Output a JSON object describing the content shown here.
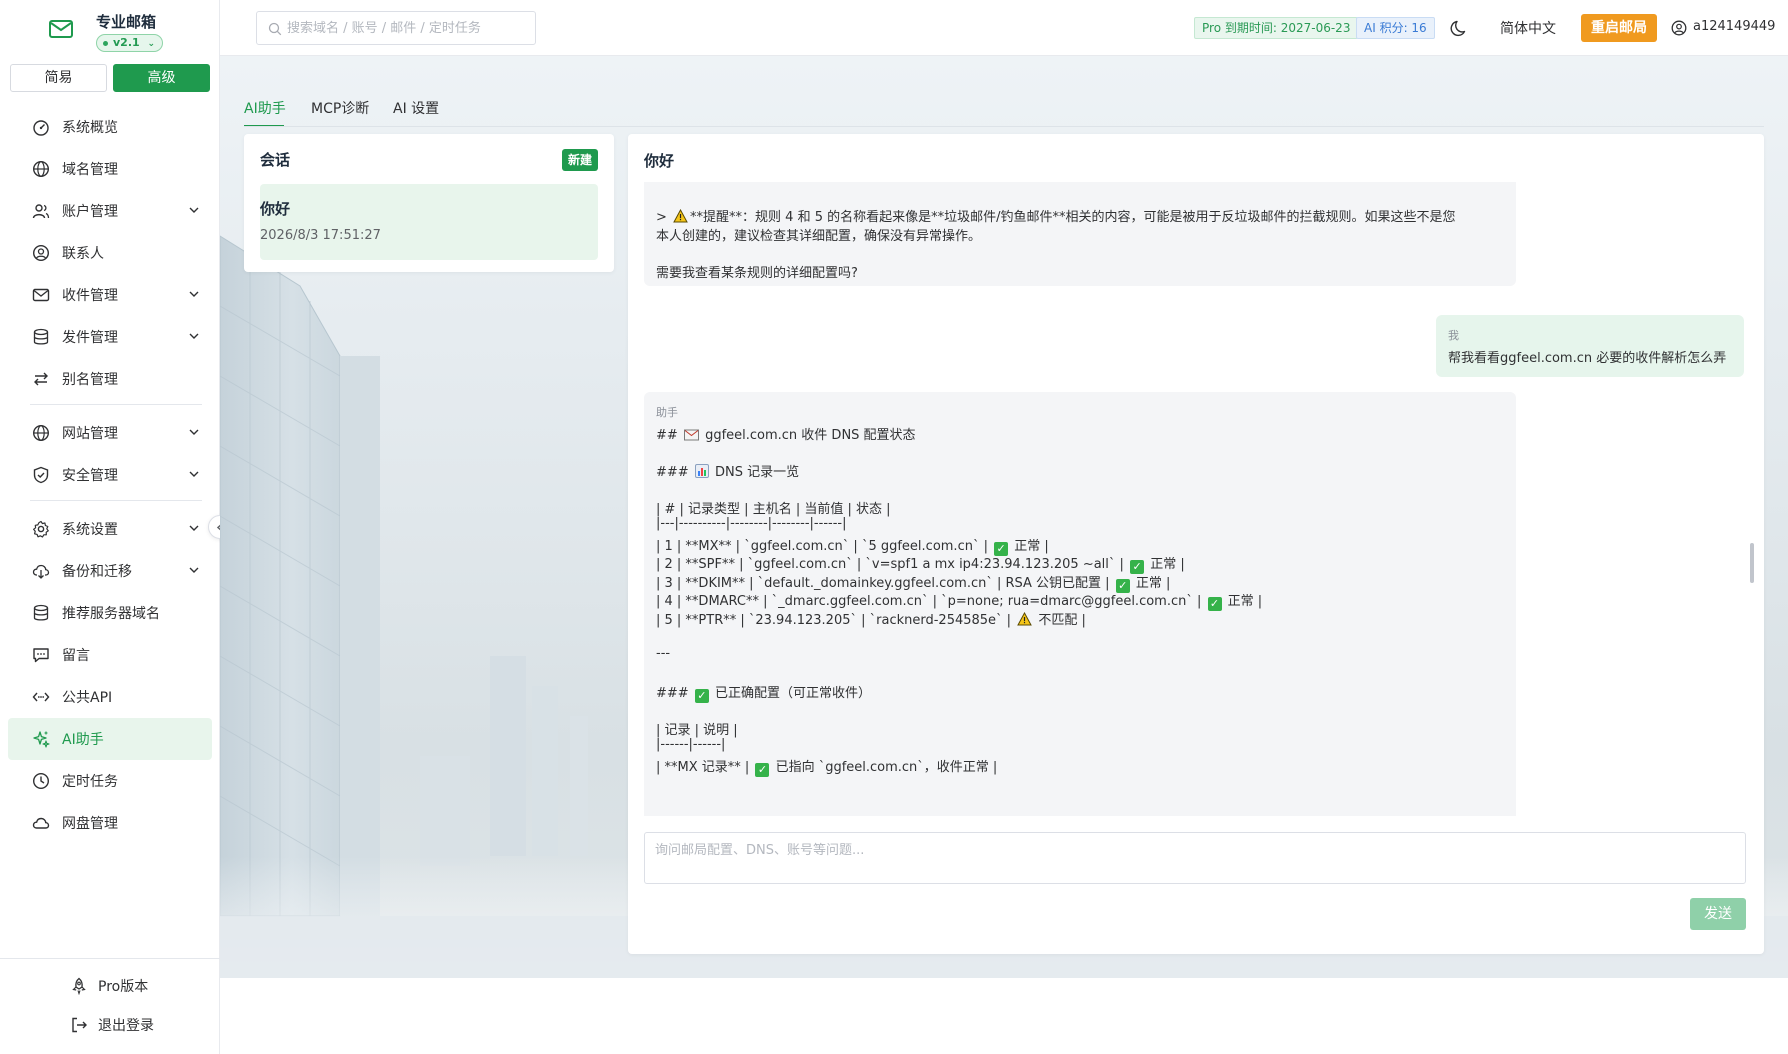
{
  "brand": {
    "title": "专业邮箱",
    "version": "v2.1"
  },
  "mode": {
    "simple": "简易",
    "advanced": "高级",
    "selected": "高级"
  },
  "sidebar": {
    "items": [
      {
        "label": "系统概览",
        "icon": "dashboard-icon",
        "expandable": false
      },
      {
        "label": "域名管理",
        "icon": "globe-icon",
        "expandable": false
      },
      {
        "label": "账户管理",
        "icon": "users-icon",
        "expandable": true
      },
      {
        "label": "联系人",
        "icon": "contact-icon",
        "expandable": false
      },
      {
        "label": "收件管理",
        "icon": "inbox-mail-icon",
        "expandable": true
      },
      {
        "label": "发件管理",
        "icon": "database-icon",
        "expandable": true
      },
      {
        "label": "别名管理",
        "icon": "swap-arrows-icon",
        "expandable": false
      },
      {
        "label": "网站管理",
        "icon": "globe-icon",
        "expandable": true
      },
      {
        "label": "安全管理",
        "icon": "shield-check-icon",
        "expandable": true
      },
      {
        "label": "系统设置",
        "icon": "gear-icon",
        "expandable": true
      },
      {
        "label": "备份和迁移",
        "icon": "cloud-download-icon",
        "expandable": true
      },
      {
        "label": "推荐服务器域名",
        "icon": "database-icon",
        "expandable": false
      },
      {
        "label": "留言",
        "icon": "chat-bubble-icon",
        "expandable": false
      },
      {
        "label": "公共API",
        "icon": "code-arrows-icon",
        "expandable": false
      },
      {
        "label": "AI助手",
        "icon": "sparkle-icon",
        "expandable": false,
        "active": true
      },
      {
        "label": "定时任务",
        "icon": "clock-icon",
        "expandable": false
      },
      {
        "label": "网盘管理",
        "icon": "cloud-icon",
        "expandable": false
      }
    ],
    "bottom": [
      {
        "label": "Pro版本",
        "icon": "rocket-icon"
      },
      {
        "label": "退出登录",
        "icon": "logout-icon"
      }
    ]
  },
  "header": {
    "search_placeholder": "搜索域名 / 账号 / 邮件 / 定时任务",
    "pro_expiry": "Pro 到期时间: 2027-06-23",
    "ai_points": "AI 积分: 16",
    "language": "简体中文",
    "restart_label": "重启邮局",
    "username": "a124149449",
    "colors": {
      "accent": "#1f9a4e",
      "restart": "#f09a1f",
      "ai_pill": "#3a7bd5"
    }
  },
  "tabs": [
    {
      "label": "AI助手",
      "active": true
    },
    {
      "label": "MCP诊断",
      "active": false
    },
    {
      "label": "AI 设置",
      "active": false
    }
  ],
  "sessions": {
    "title": "会话",
    "new_label": "新建",
    "items": [
      {
        "name": "你好",
        "time": "2026/8/3 17:51:27"
      }
    ]
  },
  "chat": {
    "title": "你好",
    "msg1": {
      "line1": "> ⚠ **提醒**：规则 4 和 5 的名称看起来像是**垃圾邮件/钓鱼邮件**相关的内容，可能是被用于反垃圾邮件的拦截规则。如果这些不是您",
      "line1_text": "**提醒**：规则 4 和 5 的名称看起来像是**垃圾邮件/钓鱼邮件**相关的内容，可能是被用于反垃圾邮件的拦截规则。如果这些不是您",
      "line2": "本人创建的，建议检查其详细配置，确保没有异常操作。",
      "line3": "需要我查看某条规则的详细配置吗?"
    },
    "user_msg": {
      "role": "我",
      "text": "帮我看看ggfeel.com.cn 必要的收件解析怎么弄"
    },
    "msg2": {
      "role": "助手",
      "h2": "ggfeel.com.cn 收件 DNS 配置状态",
      "h3a": "DNS 记录一览",
      "table_header": "| # | 记录类型 | 主机名 | 当前值 | 状态 |",
      "table_sep": "|---|----------|--------|--------|------|",
      "rows": [
        {
          "text": "| 1 | **MX** | `ggfeel.com.cn` | `5 ggfeel.com.cn` | ",
          "status": "正常 |",
          "emoji": "check"
        },
        {
          "text": "| 2 | **SPF** | `ggfeel.com.cn` | `v=spf1 a mx ip4:23.94.123.205 ~all` | ",
          "status": "正常 |",
          "emoji": "check"
        },
        {
          "text": "| 3 | **DKIM** | `default._domainkey.ggfeel.com.cn` | RSA 公钥已配置 | ",
          "status": "正常 |",
          "emoji": "check"
        },
        {
          "text": "| 4 | **DMARC** | `_dmarc.ggfeel.com.cn` | `p=none; rua=dmarc@ggfeel.com.cn` | ",
          "status": "正常 |",
          "emoji": "check"
        },
        {
          "text": "| 5 | **PTR** | `23.94.123.205` | `racknerd-254585e` | ",
          "status": "不匹配 |",
          "emoji": "warn"
        }
      ],
      "hr": "---",
      "h3b": "已正确配置（可正常收件）",
      "table2_header": "| 记录 | 说明 |",
      "table2_sep": "|------|------|",
      "table2_row": "| **MX 记录** | ",
      "table2_row_tail": "已指向 `ggfeel.com.cn`，收件正常 |"
    },
    "composer_placeholder": "询问邮局配置、DNS、账号等问题...",
    "send_label": "发送"
  }
}
